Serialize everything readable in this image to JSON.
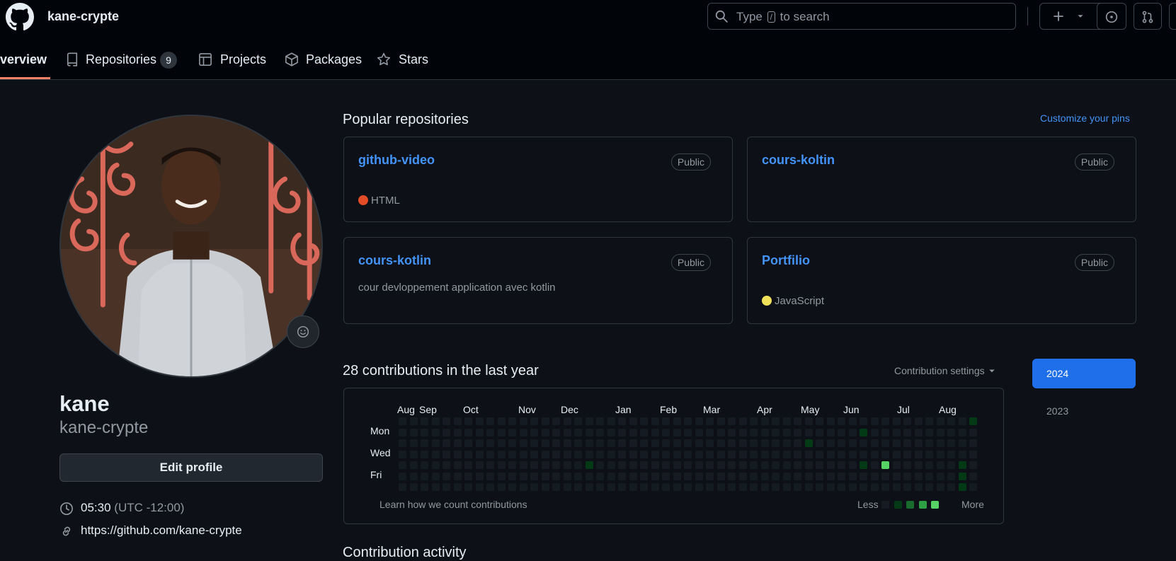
{
  "header": {
    "owner": "kane-crypte",
    "search": {
      "before": "Type",
      "key": "/",
      "after": "to search"
    },
    "icons": [
      "github-logo-icon",
      "search-icon",
      "plus-icon",
      "chevron-down-icon",
      "issues-icon",
      "pull-request-icon"
    ]
  },
  "tabs": [
    {
      "label": "verview",
      "active": true,
      "icon": "book-open-icon"
    },
    {
      "label": "Repositories",
      "count": "9",
      "icon": "repo-icon"
    },
    {
      "label": "Projects",
      "icon": "table-icon"
    },
    {
      "label": "Packages",
      "icon": "package-icon"
    },
    {
      "label": "Stars",
      "icon": "star-icon"
    }
  ],
  "profile": {
    "name": "kane",
    "login": "kane-crypte",
    "edit_label": "Edit profile",
    "time": "05:30",
    "timezone": "(UTC -12:00)",
    "website": "https://github.com/kane-crypte"
  },
  "popular": {
    "title": "Popular repositories",
    "customize": "Customize your pins",
    "repos": [
      {
        "name": "github-video",
        "visibility": "Public",
        "description": "",
        "language": "HTML",
        "lang_color": "#e34c26"
      },
      {
        "name": "cours-koltin",
        "visibility": "Public",
        "description": "",
        "language": "",
        "lang_color": ""
      },
      {
        "name": "cours-kotlin",
        "visibility": "Public",
        "description": "cour devloppement application avec kotlin",
        "language": "",
        "lang_color": ""
      },
      {
        "name": "Portfilio",
        "visibility": "Public",
        "description": "",
        "language": "JavaScript",
        "lang_color": "#f1e05a"
      }
    ]
  },
  "contributions": {
    "title": "28 contributions in the last year",
    "settings": "Contribution settings",
    "months": [
      "Aug",
      "Sep",
      "Oct",
      "Nov",
      "Dec",
      "Jan",
      "Feb",
      "Mar",
      "Apr",
      "May",
      "Jun",
      "Jul",
      "Aug"
    ],
    "days": [
      "Mon",
      "Wed",
      "Fri"
    ],
    "learn": "Learn how we count contributions",
    "legend_less": "Less",
    "legend_more": "More",
    "weeks": 53,
    "active_cells": [
      {
        "week": 17,
        "day": 4,
        "level": 1
      },
      {
        "week": 37,
        "day": 2,
        "level": 1
      },
      {
        "week": 42,
        "day": 1,
        "level": 1
      },
      {
        "week": 42,
        "day": 4,
        "level": 1
      },
      {
        "week": 44,
        "day": 4,
        "level": 4
      },
      {
        "week": 51,
        "day": 4,
        "level": 1
      },
      {
        "week": 51,
        "day": 5,
        "level": 1
      },
      {
        "week": 51,
        "day": 6,
        "level": 1
      },
      {
        "week": 52,
        "day": 0,
        "level": 1
      }
    ],
    "level_colors": [
      "#151b23",
      "#033a16",
      "#196c2e",
      "#2ea043",
      "#56d364"
    ]
  },
  "years": {
    "selected": "2024",
    "other": "2023"
  },
  "next_section": "Contribution activity"
}
